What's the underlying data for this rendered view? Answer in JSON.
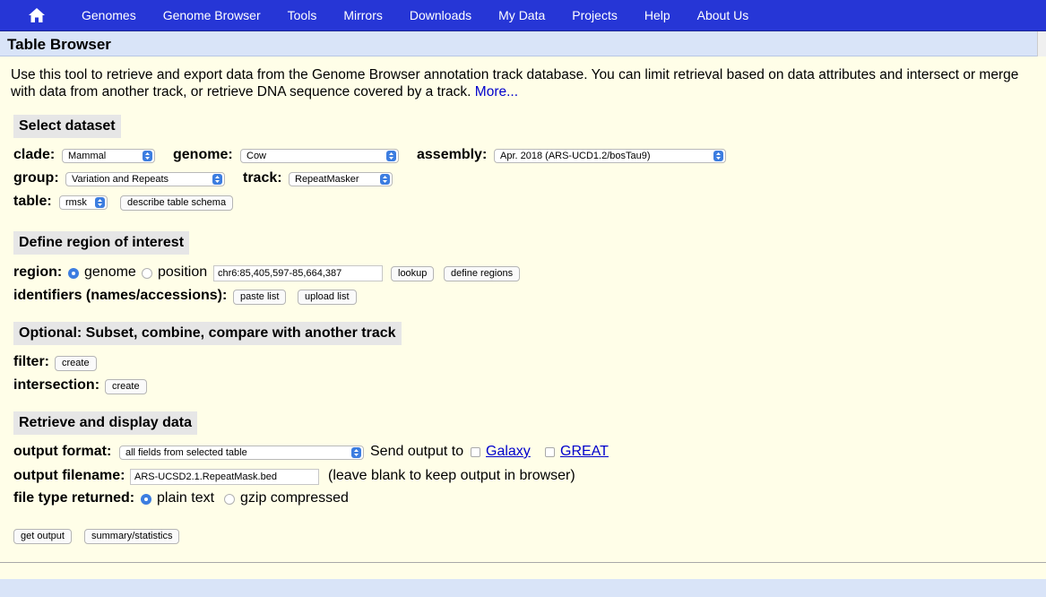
{
  "nav": {
    "home_icon": "home-icon",
    "items": [
      "Genomes",
      "Genome Browser",
      "Tools",
      "Mirrors",
      "Downloads",
      "My Data",
      "Projects",
      "Help",
      "About Us"
    ]
  },
  "page_title": "Table Browser",
  "intro": {
    "text": "Use this tool to retrieve and export data from the Genome Browser annotation track database. You can limit retrieval based on data attributes and intersect or merge with data from another track, or retrieve DNA sequence covered by a track.",
    "more_link": "More..."
  },
  "dataset": {
    "heading": "Select dataset",
    "clade_label": "clade:",
    "clade_value": "Mammal",
    "genome_label": "genome:",
    "genome_value": "Cow",
    "assembly_label": "assembly:",
    "assembly_value": "Apr. 2018 (ARS-UCD1.2/bosTau9)",
    "group_label": "group:",
    "group_value": "Variation and Repeats",
    "track_label": "track:",
    "track_value": "RepeatMasker",
    "table_label": "table:",
    "table_value": "rmsk",
    "describe_button": "describe table schema"
  },
  "region": {
    "heading": "Define region of interest",
    "region_label": "region:",
    "genome_option": "genome",
    "genome_selected": true,
    "position_option": "position",
    "position_value": "chr6:85,405,597-85,664,387",
    "lookup_button": "lookup",
    "define_button": "define regions",
    "identifiers_label": "identifiers (names/accessions):",
    "paste_button": "paste list",
    "upload_button": "upload list"
  },
  "optional": {
    "heading": "Optional: Subset, combine, compare with another track",
    "filter_label": "filter:",
    "filter_button": "create",
    "intersection_label": "intersection:",
    "intersection_button": "create"
  },
  "retrieve": {
    "heading": "Retrieve and display data",
    "format_label": "output format:",
    "format_value": "all fields from selected table",
    "send_label": "Send output to",
    "galaxy_link": "Galaxy",
    "great_link": "GREAT",
    "filename_label": "output filename:",
    "filename_value": "ARS-UCSD2.1.RepeatMask.bed",
    "filename_hint": "(leave blank to keep output in browser)",
    "filetype_label": "file type returned:",
    "plain_option": "plain text",
    "plain_selected": true,
    "gzip_option": "gzip compressed",
    "get_output_button": "get output",
    "summary_button": "summary/statistics"
  },
  "colors": {
    "nav_bg": "#2636d6",
    "page_bg": "#fffee8",
    "title_bg": "#d9e4f8",
    "accent": "#3c7de0"
  }
}
